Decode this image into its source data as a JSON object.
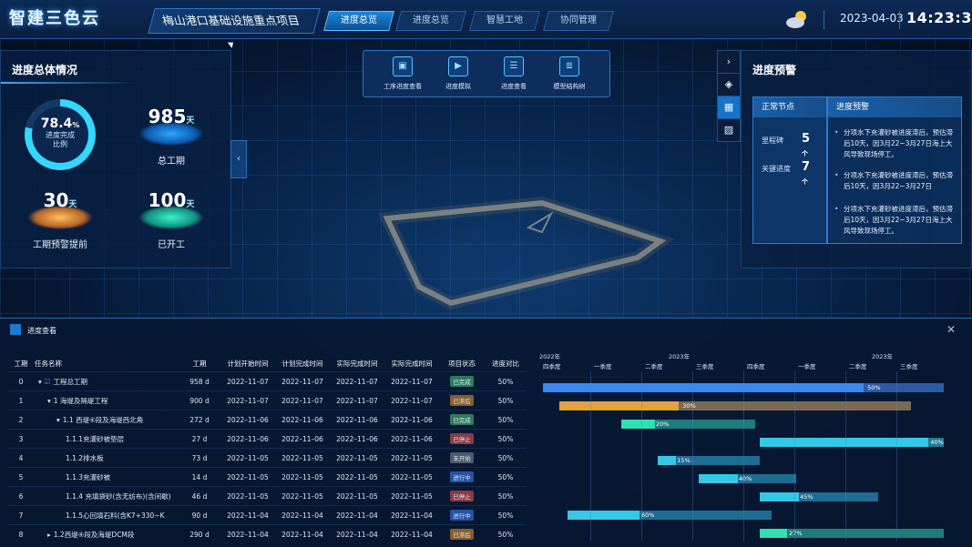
{
  "header": {
    "logo": "智建三色云",
    "project": "梅山港口基础设施重点项目",
    "tabs": [
      {
        "label": "进度总览",
        "active": true
      },
      {
        "label": "进度总览",
        "active": false
      },
      {
        "label": "智慧工地",
        "active": false
      },
      {
        "label": "协同管理",
        "active": false
      }
    ],
    "weather_icon": "partly-cloudy-icon",
    "date": "2023-04-03",
    "time": "14:23:32"
  },
  "left_panel": {
    "title": "进度总体情况",
    "completion": {
      "value": "78.4",
      "unit": "%",
      "label_line1": "进度完成",
      "label_line2": "比例",
      "fraction": 0.784
    },
    "total_days": {
      "value": "985",
      "unit": "天",
      "label": "总工期"
    },
    "ahead_days": {
      "value": "30",
      "unit": "天",
      "label": "工期预警提前"
    },
    "started_days": {
      "value": "100",
      "unit": "天",
      "label": "已开工"
    }
  },
  "toolbar": {
    "items": [
      {
        "label": "工序进度查看",
        "icon": "process-view-icon"
      },
      {
        "label": "进度模拟",
        "icon": "simulation-play-icon"
      },
      {
        "label": "进度查看",
        "icon": "progress-list-icon"
      },
      {
        "label": "模型结构树",
        "icon": "model-tree-icon"
      }
    ]
  },
  "side_buttons": [
    "chevron-right-icon",
    "layers-icon",
    "cube-icon",
    "hatch-icon"
  ],
  "right_panel": {
    "title": "进度预警",
    "normal_title": "正常节点",
    "milestone_label": "里程碑",
    "milestone_value": "5",
    "milestone_unit": "个",
    "key_label": "关键进度",
    "key_value": "7",
    "key_unit": "个",
    "warning_title": "进度预警",
    "warnings": [
      "分项水下充灌砂被进度滞后，预估滞后10天，因3月22~3月27日海上大风导致现场停工。",
      "分项水下充灌砂被进度滞后，预估滞后10天，因3月22~3月27日",
      "分项水下充灌砂被进度滞后，预估滞后10天，因3月22~3月27日海上大风导致现场停工。"
    ]
  },
  "bottom_panel": {
    "title": "进度查看",
    "columns": [
      "工期",
      "任务名称",
      "工期",
      "计划开始时间",
      "计划完成时间",
      "实际完成时间",
      "实际完成时间",
      "项目状态",
      "进度对比"
    ],
    "rows": [
      {
        "idx": "0",
        "name": "工程总工期",
        "level": 0,
        "arrow": "▾",
        "dur": "958 d",
        "ps": "2022–11–07",
        "pe": "2022–11–07",
        "as": "2022–11–07",
        "ae": "2022–11–07",
        "status": "已完成",
        "pct": "50%"
      },
      {
        "idx": "1",
        "name": "1 海堤及隔堤工程",
        "level": 1,
        "arrow": "▾",
        "dur": "900 d",
        "ps": "2022–11–07",
        "pe": "2022–11–07",
        "as": "2022–11–07",
        "ae": "2022–11–07",
        "status": "已滞后",
        "pct": "50%"
      },
      {
        "idx": "2",
        "name": "1.1 西堤④段及海堤西北角",
        "level": 2,
        "arrow": "▾",
        "dur": "272 d",
        "ps": "2022–11–06",
        "pe": "2022–11–06",
        "as": "2022–11–06",
        "ae": "2022–11–06",
        "status": "已完成",
        "pct": "50%"
      },
      {
        "idx": "3",
        "name": "1.1.1充灌砂被垫层",
        "level": 3,
        "arrow": "",
        "dur": "27 d",
        "ps": "2022–11–06",
        "pe": "2022–11–06",
        "as": "2022–11–06",
        "ae": "2022–11–06",
        "status": "已停止",
        "pct": "50%"
      },
      {
        "idx": "4",
        "name": "1.1.2排水板",
        "level": 3,
        "arrow": "",
        "dur": "73 d",
        "ps": "2022–11–05",
        "pe": "2022–11–05",
        "as": "2022–11–05",
        "ae": "2022–11–05",
        "status": "未开始",
        "pct": "50%"
      },
      {
        "idx": "5",
        "name": "1.1.3充灌砂被",
        "level": 3,
        "arrow": "",
        "dur": "14 d",
        "ps": "2022–11–05",
        "pe": "2022–11–05",
        "as": "2022–11–05",
        "ae": "2022–11–05",
        "status": "进行中",
        "pct": "50%"
      },
      {
        "idx": "6",
        "name": "1.1.4 充填袋砂(含无纺布)(含间歇)",
        "level": 3,
        "arrow": "",
        "dur": "46 d",
        "ps": "2022–11–05",
        "pe": "2022–11–05",
        "as": "2022–11–05",
        "ae": "2022–11–05",
        "status": "已停止",
        "pct": "50%"
      },
      {
        "idx": "7",
        "name": "1.1.5心回填石料(含K7+330~K",
        "level": 3,
        "arrow": "",
        "dur": "90 d",
        "ps": "2022–11–04",
        "pe": "2022–11–04",
        "as": "2022–11–04",
        "ae": "2022–11–04",
        "status": "进行中",
        "pct": "50%"
      },
      {
        "idx": "8",
        "name": "1.2西堤④段及海堤DCM段",
        "level": 1,
        "arrow": "▸",
        "dur": "290 d",
        "ps": "2022–11–04",
        "pe": "2022–11–04",
        "as": "2022–11–04",
        "ae": "2022–11–04",
        "status": "已滞后",
        "pct": "50%"
      }
    ],
    "gantt": {
      "years": [
        "2022年",
        "2023年",
        "2023年"
      ],
      "quarters": [
        "四季度",
        "一季度",
        "二季度",
        "三季度",
        "四季度",
        "一季度",
        "二季度",
        "三季度"
      ],
      "bars": [
        {
          "start": 0.01,
          "end": 0.99,
          "progress": 0.8,
          "label": "50%",
          "color": "#3c86f0",
          "track": "#2c5aa6"
        },
        {
          "start": 0.05,
          "end": 0.91,
          "progress": 0.34,
          "label": "30%",
          "color": "#e3a23c",
          "track": "#7b6a53"
        },
        {
          "start": 0.2,
          "end": 0.53,
          "progress": 0.25,
          "label": "20%",
          "color": "#31e0b0",
          "track": "#1f7c7d"
        },
        {
          "start": 0.54,
          "end": 0.99,
          "progress": 0.92,
          "label": "40%",
          "color": "#33c9e6",
          "track": "#1f7c8d"
        },
        {
          "start": 0.29,
          "end": 0.54,
          "progress": 0.18,
          "label": "15%",
          "color": "#33c9e6",
          "track": "#1d6d92"
        },
        {
          "start": 0.39,
          "end": 0.63,
          "progress": 0.4,
          "label": "40%",
          "color": "#33c9e6",
          "track": "#1d6d92"
        },
        {
          "start": 0.54,
          "end": 0.83,
          "progress": 0.33,
          "label": "45%",
          "color": "#33c9e6",
          "track": "#1d6d92"
        },
        {
          "start": 0.07,
          "end": 0.57,
          "progress": 0.35,
          "label": "60%",
          "color": "#33c9e6",
          "track": "#1d6d92"
        },
        {
          "start": 0.54,
          "end": 0.99,
          "progress": 0.15,
          "label": "27%",
          "color": "#31e0b0",
          "track": "#1f7c7d"
        }
      ]
    },
    "status_colors": {
      "已完成": "#2f7a5d",
      "已滞后": "#8a5e2c",
      "已停止": "#8a3a44",
      "未开始": "#4e5a6a",
      "进行中": "#2453a6"
    }
  }
}
